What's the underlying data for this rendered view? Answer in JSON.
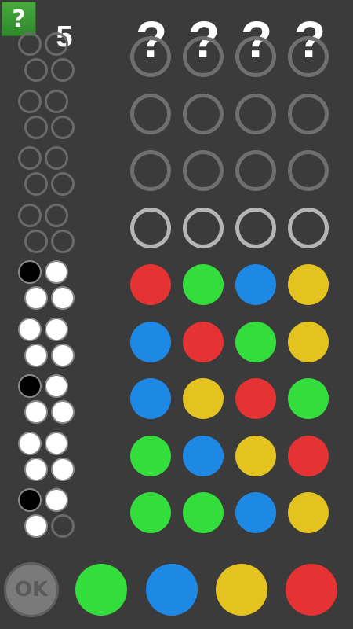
{
  "header": {
    "help_label": "?",
    "remaining_count": "5",
    "secret_slots": [
      "?",
      "?",
      "?",
      "?"
    ]
  },
  "colors": {
    "red": "#e53233",
    "green": "#33dd3b",
    "blue": "#1e88e5",
    "yellow": "#e4c320",
    "empty_ring": "#6f6f6f",
    "active_ring": "#b5b5b5"
  },
  "board": {
    "rows": [
      {
        "guess": [
          "empty",
          "empty",
          "empty",
          "empty"
        ],
        "hints": [
          "empty",
          "empty",
          "empty",
          "empty"
        ],
        "partially_visible": true
      },
      {
        "guess": [
          "empty",
          "empty",
          "empty",
          "empty"
        ],
        "hints": [
          "empty",
          "empty",
          "empty",
          "empty"
        ]
      },
      {
        "guess": [
          "empty",
          "empty",
          "empty",
          "empty"
        ],
        "hints": [
          "empty",
          "empty",
          "empty",
          "empty"
        ]
      },
      {
        "guess": [
          "empty",
          "empty",
          "empty",
          "empty"
        ],
        "hints": [
          "empty",
          "empty",
          "empty",
          "empty"
        ],
        "active": true
      },
      {
        "guess": [
          "red",
          "green",
          "blue",
          "yellow"
        ],
        "hints": [
          "black",
          "white",
          "white",
          "white"
        ]
      },
      {
        "guess": [
          "blue",
          "red",
          "green",
          "yellow"
        ],
        "hints": [
          "white",
          "white",
          "white",
          "white"
        ]
      },
      {
        "guess": [
          "blue",
          "yellow",
          "red",
          "green"
        ],
        "hints": [
          "black",
          "white",
          "white",
          "white"
        ]
      },
      {
        "guess": [
          "green",
          "blue",
          "yellow",
          "red"
        ],
        "hints": [
          "white",
          "white",
          "white",
          "white"
        ]
      },
      {
        "guess": [
          "green",
          "green",
          "blue",
          "yellow"
        ],
        "hints": [
          "black",
          "white",
          "white",
          "empty"
        ]
      }
    ]
  },
  "controls": {
    "ok_label": "OK",
    "palette": [
      "green",
      "blue",
      "yellow",
      "red"
    ]
  }
}
